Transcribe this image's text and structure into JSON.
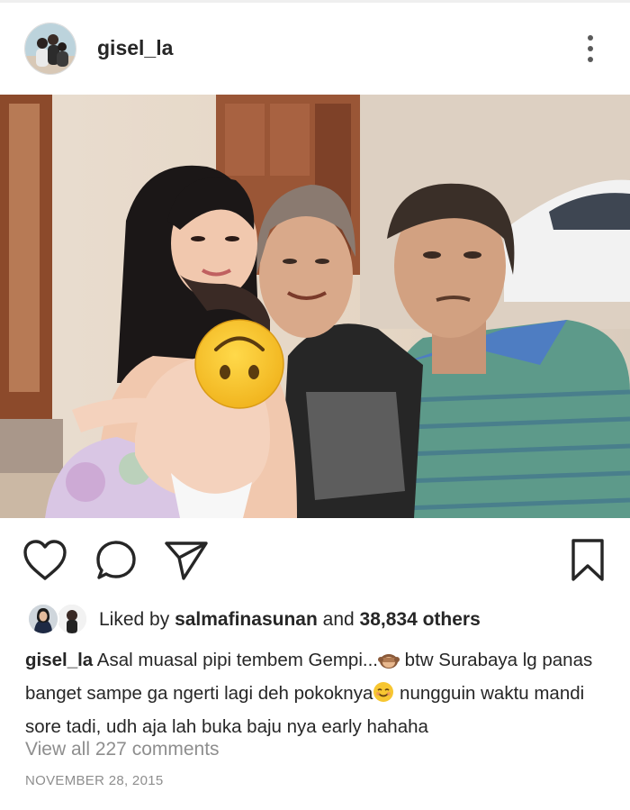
{
  "post": {
    "username": "gisel_la",
    "more_icon": "more-vertical-icon"
  },
  "actions": {
    "like_icon": "heart-icon",
    "comment_icon": "comment-icon",
    "share_icon": "send-icon",
    "save_icon": "bookmark-icon"
  },
  "likes": {
    "prefix": "Liked by",
    "liker": "salmafinasunan",
    "conjunction": "and",
    "others": "38,834 others"
  },
  "caption": {
    "username": "gisel_la",
    "part1": "Asal muasal pipi tembem Gempi...",
    "part2": " btw Surabaya lg panas banget sampe ga ngerti lagi deh pokoknya",
    "part3": " nungguin waktu mandi sore tadi, udh aja lah buka baju nya early hahaha"
  },
  "comments": {
    "view_all": "View all 227 comments"
  },
  "date": "NOVEMBER 28, 2015",
  "colors": {
    "text": "#262626",
    "secondary": "#8e8e8e",
    "emoji_yellow": "#f7c631"
  }
}
